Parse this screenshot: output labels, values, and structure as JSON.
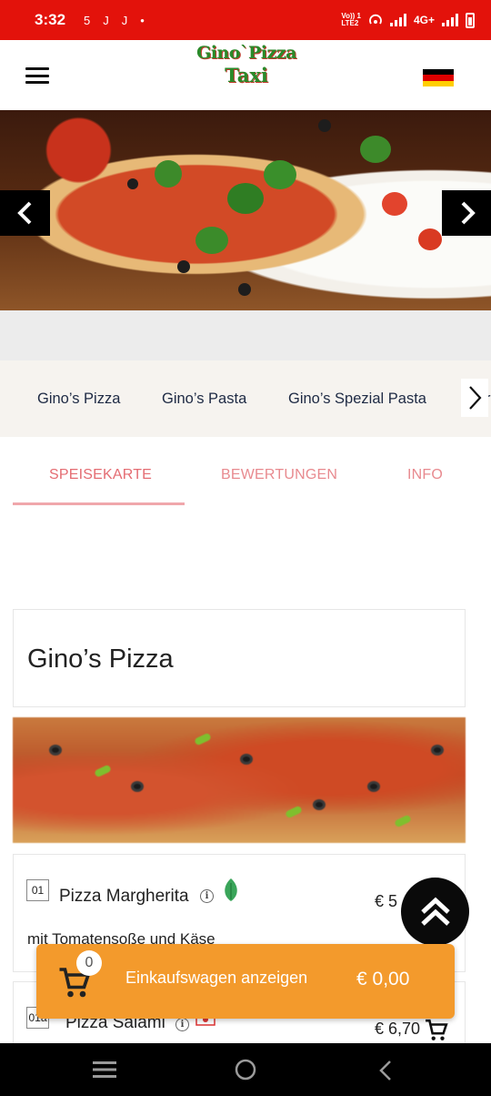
{
  "status_bar": {
    "time": "3:32",
    "notification_icons": [
      "5",
      "J",
      "J",
      "•"
    ],
    "network_label_top": "Vo)) 1",
    "network_label_bottom": "LTE2",
    "network_type": "4G+"
  },
  "header": {
    "logo_line1": "Gino`Pizza",
    "logo_line2": "Taxi",
    "menu_icon": "hamburger-icon",
    "language_flag": "germany-flag",
    "flag_colors": [
      "#000000",
      "#dd0000",
      "#ffce00"
    ]
  },
  "hero": {
    "prev_icon": "chevron-left-icon",
    "next_icon": "chevron-right-icon"
  },
  "categories": {
    "items": [
      "Gino’s Pizza",
      "Gino’s Pasta",
      "Gino’s Spezial Pasta"
    ],
    "peek": "r",
    "next_icon": "chevron-right-icon"
  },
  "tabs": {
    "items": [
      "SPEISEKARTE",
      "BEWERTUNGEN",
      "INFO"
    ],
    "active": "SPEISEKARTE"
  },
  "menu": {
    "section_title": "Gino’s Pizza",
    "items": [
      {
        "number": "01",
        "name": "Pizza Margherita",
        "price": "€ 5",
        "description": "mit Tomatensoße und Käse",
        "badge": "vegetarian-leaf-icon"
      },
      {
        "number": "01a",
        "name": "Pizza Salami",
        "price": "€ 6,70",
        "badge": "spicy-icon"
      }
    ]
  },
  "cart": {
    "count": "0",
    "label": "Einkaufswagen anzeigen",
    "total": "€ 0,00"
  },
  "colors": {
    "status_bar": "#e3120b",
    "accent_tab": "#e46c72",
    "cart_bar": "#f39a2c",
    "category_text": "#1e2a44"
  }
}
